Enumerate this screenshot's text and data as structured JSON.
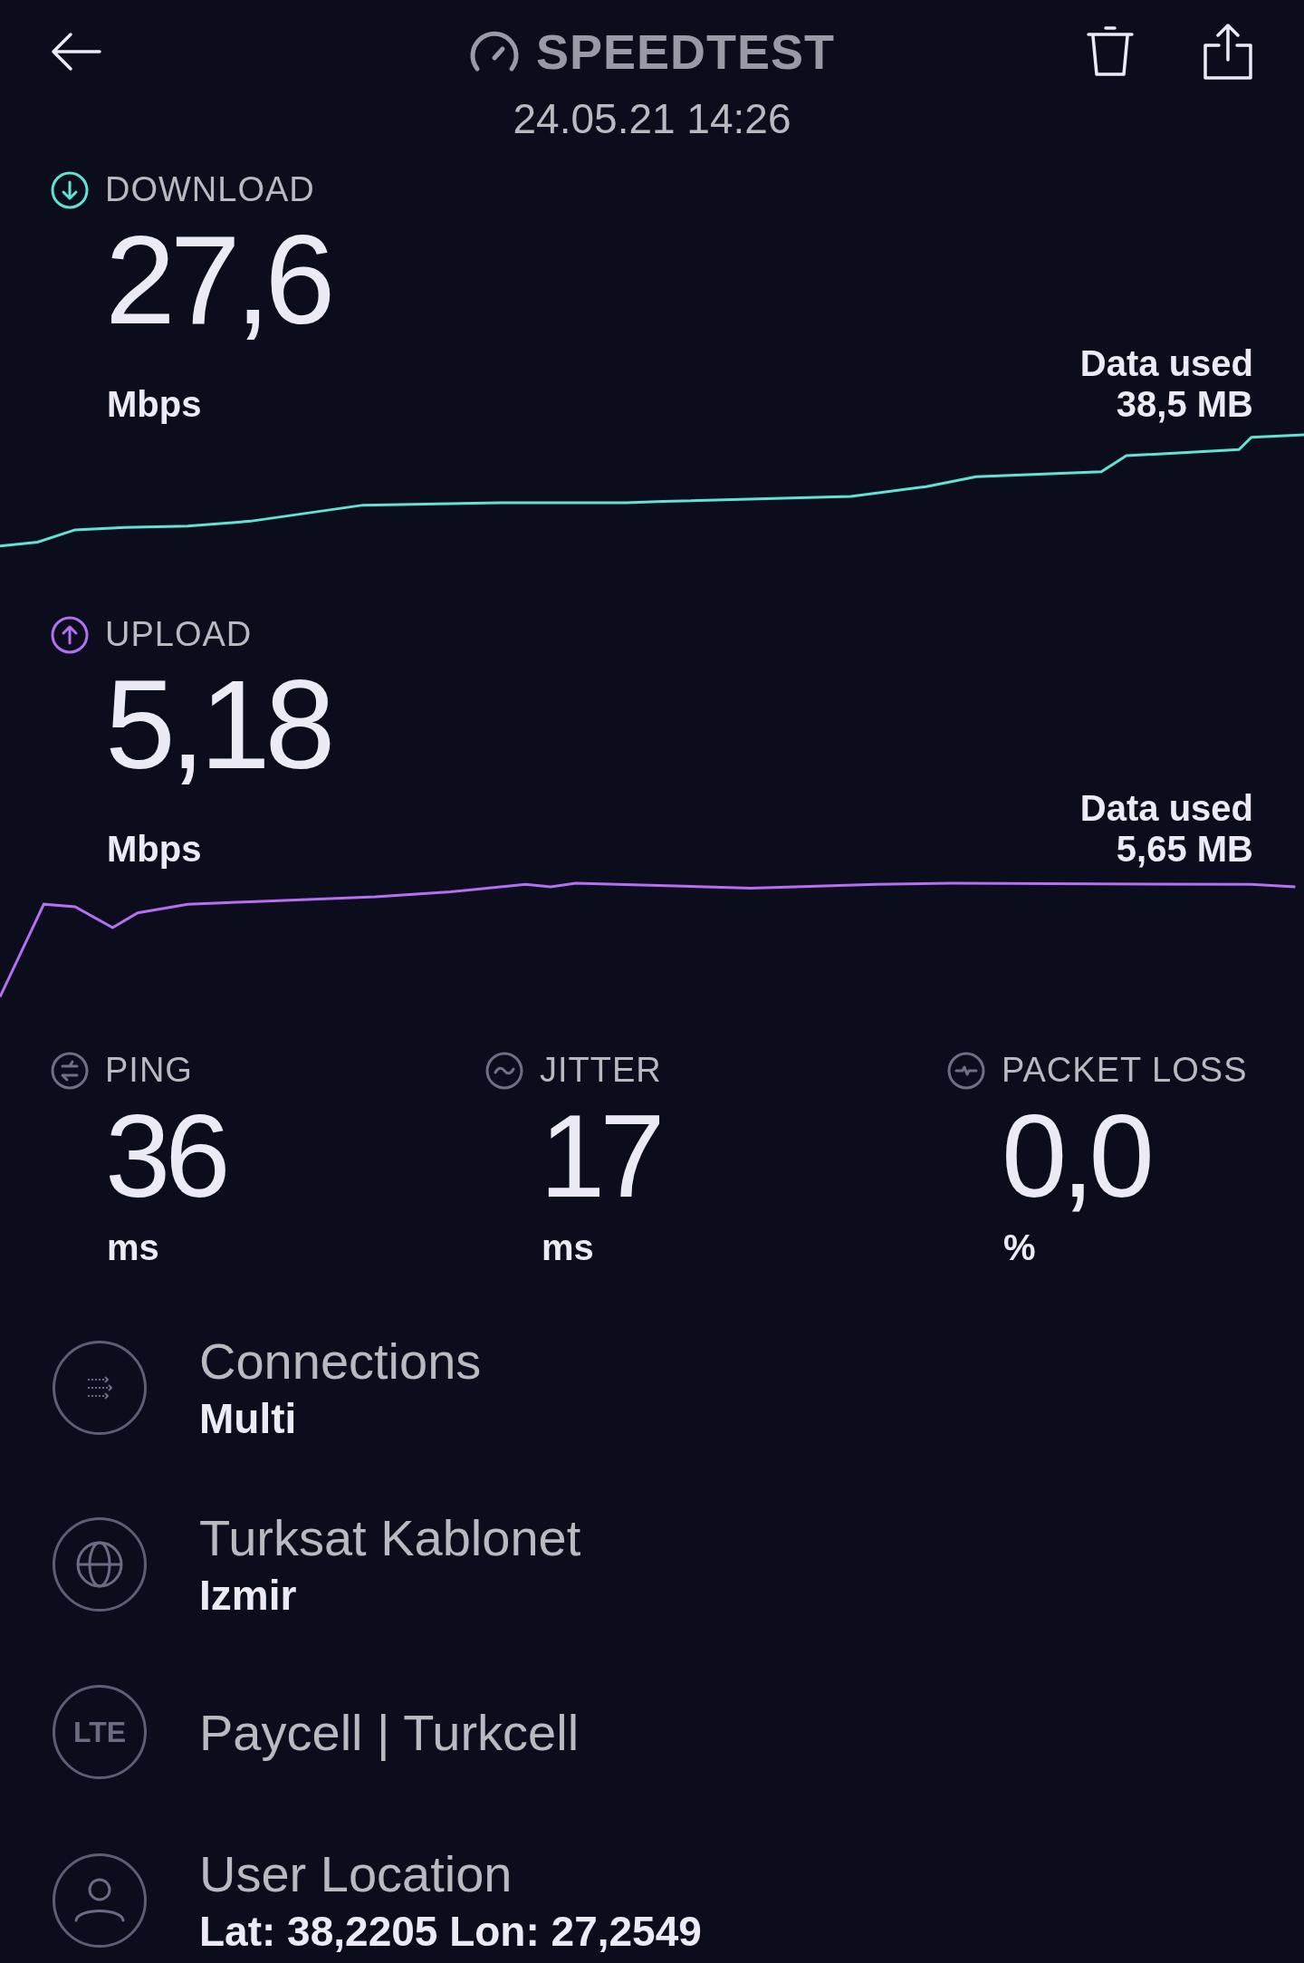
{
  "header": {
    "title": "SPEEDTEST",
    "date": "24.05.21 14:26"
  },
  "speeds": [
    {
      "kind": "download",
      "label": "DOWNLOAD",
      "value": "27,6",
      "unit": "Mbps",
      "data_used_label": "Data used",
      "data_used": "38,5 MB"
    },
    {
      "kind": "upload",
      "label": "UPLOAD",
      "value": "5,18",
      "unit": "Mbps",
      "data_used_label": "Data used",
      "data_used": "5,65 MB"
    }
  ],
  "metrics": [
    {
      "kind": "ping",
      "label": "PING",
      "value": "36",
      "unit": "ms"
    },
    {
      "kind": "jitter",
      "label": "JITTER",
      "value": "17",
      "unit": "ms"
    },
    {
      "kind": "packet_loss",
      "label": "PACKET LOSS",
      "value": "0,0",
      "unit": "%"
    }
  ],
  "details": [
    {
      "kind": "connections",
      "title": "Connections",
      "value": "Multi"
    },
    {
      "kind": "server",
      "title": "Turksat Kablonet",
      "value": "Izmir"
    },
    {
      "kind": "network",
      "badge": "LTE",
      "title": "Paycell | Turkcell"
    },
    {
      "kind": "location",
      "title": "User Location",
      "value": "Lat: 38,2205 Lon: 27,2549"
    }
  ]
}
